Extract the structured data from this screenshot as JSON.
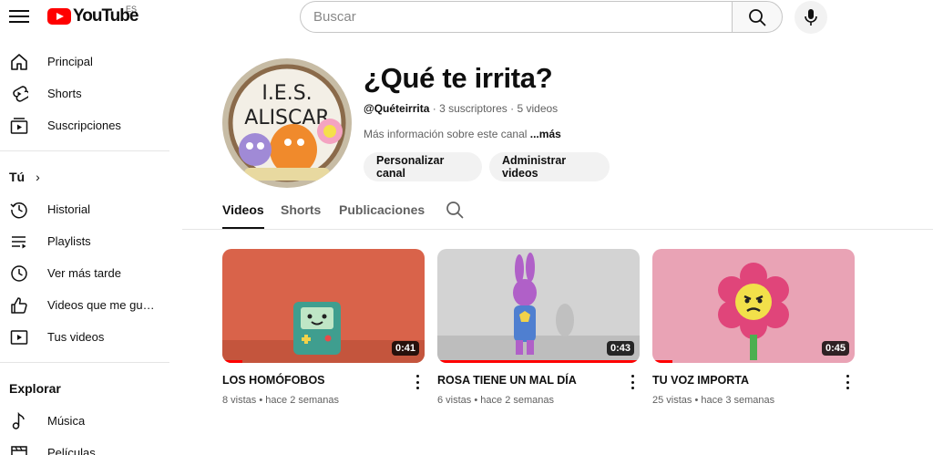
{
  "header": {
    "logo_text": "YouTube",
    "country_code": "ES",
    "search_placeholder": "Buscar"
  },
  "sidebar": {
    "main": [
      {
        "label": "Principal",
        "icon": "home-icon"
      },
      {
        "label": "Shorts",
        "icon": "shorts-icon"
      },
      {
        "label": "Suscripciones",
        "icon": "subscriptions-icon"
      }
    ],
    "you_heading": "Tú",
    "you": [
      {
        "label": "Historial",
        "icon": "history-icon"
      },
      {
        "label": "Playlists",
        "icon": "playlists-icon"
      },
      {
        "label": "Ver más tarde",
        "icon": "watch-later-icon"
      },
      {
        "label": "Videos que me gustan",
        "icon": "like-icon"
      },
      {
        "label": "Tus videos",
        "icon": "your-videos-icon"
      }
    ],
    "explore_heading": "Explorar",
    "explore": [
      {
        "label": "Música",
        "icon": "music-icon"
      },
      {
        "label": "Películas",
        "icon": "movies-icon"
      }
    ]
  },
  "channel": {
    "name": "¿Qué te irrita?",
    "avatar_text": "I.E.S. ALISCAR",
    "handle": "@Quéteirrita",
    "subscribers": "3 suscriptores",
    "videos_count": "5 videos",
    "separator": "·",
    "description": "Más información sobre este canal",
    "more_label": "...más",
    "customize_button": "Personalizar canal",
    "manage_button": "Administrar videos"
  },
  "tabs": [
    {
      "label": "Videos",
      "active": true
    },
    {
      "label": "Shorts",
      "active": false
    },
    {
      "label": "Publicaciones",
      "active": false
    }
  ],
  "videos": [
    {
      "title": "LOS HOMÓFOBOS",
      "views": "8 vistas",
      "age": "hace 2 semanas",
      "duration": "0:41",
      "progress": 0.1,
      "bg_color": "#d9634a"
    },
    {
      "title": "ROSA TIENE UN MAL DÍA",
      "views": "6 vistas",
      "age": "hace 2 semanas",
      "duration": "0:43",
      "progress": 1.0,
      "bg_color": "#cfcfcf"
    },
    {
      "title": "TU VOZ IMPORTA",
      "views": "25 vistas",
      "age": "hace 3 semanas",
      "duration": "0:45",
      "progress": 0.1,
      "bg_color": "#e9a3b5"
    }
  ],
  "colors": {
    "brand_red": "#ff0000",
    "text_primary": "#0f0f0f",
    "text_secondary": "#606060"
  }
}
